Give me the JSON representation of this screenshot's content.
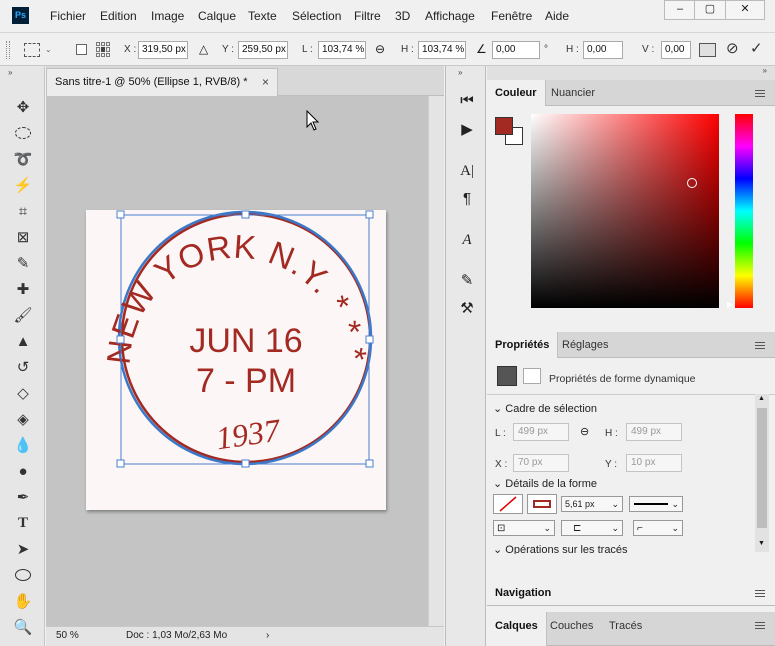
{
  "menu": {
    "logo": "Ps",
    "items": [
      "Fichier",
      "Edition",
      "Image",
      "Calque",
      "Texte",
      "Sélection",
      "Filtre",
      "3D",
      "Affichage",
      "Fenêtre",
      "Aide"
    ]
  },
  "window_controls": {
    "minimize": "–",
    "maximize": "▢",
    "close": "✕"
  },
  "options_bar": {
    "x_label": "X :",
    "x_value": "319,50 px",
    "y_label": "Y :",
    "y_value": "259,50 px",
    "l_label": "L :",
    "l_value": "103,74 %",
    "h_label": "H :",
    "h_value": "103,74 %",
    "angle_value": "0,00",
    "angle_unit": "°",
    "hskew_label": "H :",
    "hskew_value": "0,00",
    "vskew_label": "V :",
    "vskew_value": "0,00"
  },
  "document": {
    "tab_title": "Sans titre-1 @ 50% (Ellipse 1, RVB/8) *",
    "tab_close": "×",
    "zoom": "50 %",
    "doc_info": "Doc : 1,03 Mo/2,63 Mo",
    "status_arrow": "›"
  },
  "stamp": {
    "arc_text": "NEW YORK N.Y. * * *",
    "line1": "JUN 16",
    "line2": "7 - PM",
    "year": "1937",
    "ink_color": "#a32a22",
    "ellipse_stroke": "#3b78c8"
  },
  "color_panel": {
    "tabs": [
      "Couleur",
      "Nuancier"
    ],
    "foreground": "#a32a22",
    "background": "#ffffff",
    "hue_field_color": "#ff0000"
  },
  "properties_panel": {
    "tabs": [
      "Propriétés",
      "Réglages"
    ],
    "title": "Propriétés de forme dynamique",
    "section_bbox": "Cadre de sélection",
    "l_label": "L :",
    "l_value": "499 px",
    "h_label": "H :",
    "h_value": "499 px",
    "x_label": "X :",
    "x_value": "70 px",
    "y_label": "Y :",
    "y_value": "10 px",
    "section_shape": "Détails de la forme",
    "stroke_width": "5,61 px",
    "section_ops": "Opérations sur les tracés"
  },
  "navigation_panel": {
    "title": "Navigation"
  },
  "layers_panel": {
    "tabs": [
      "Calques",
      "Couches",
      "Tracés"
    ]
  }
}
